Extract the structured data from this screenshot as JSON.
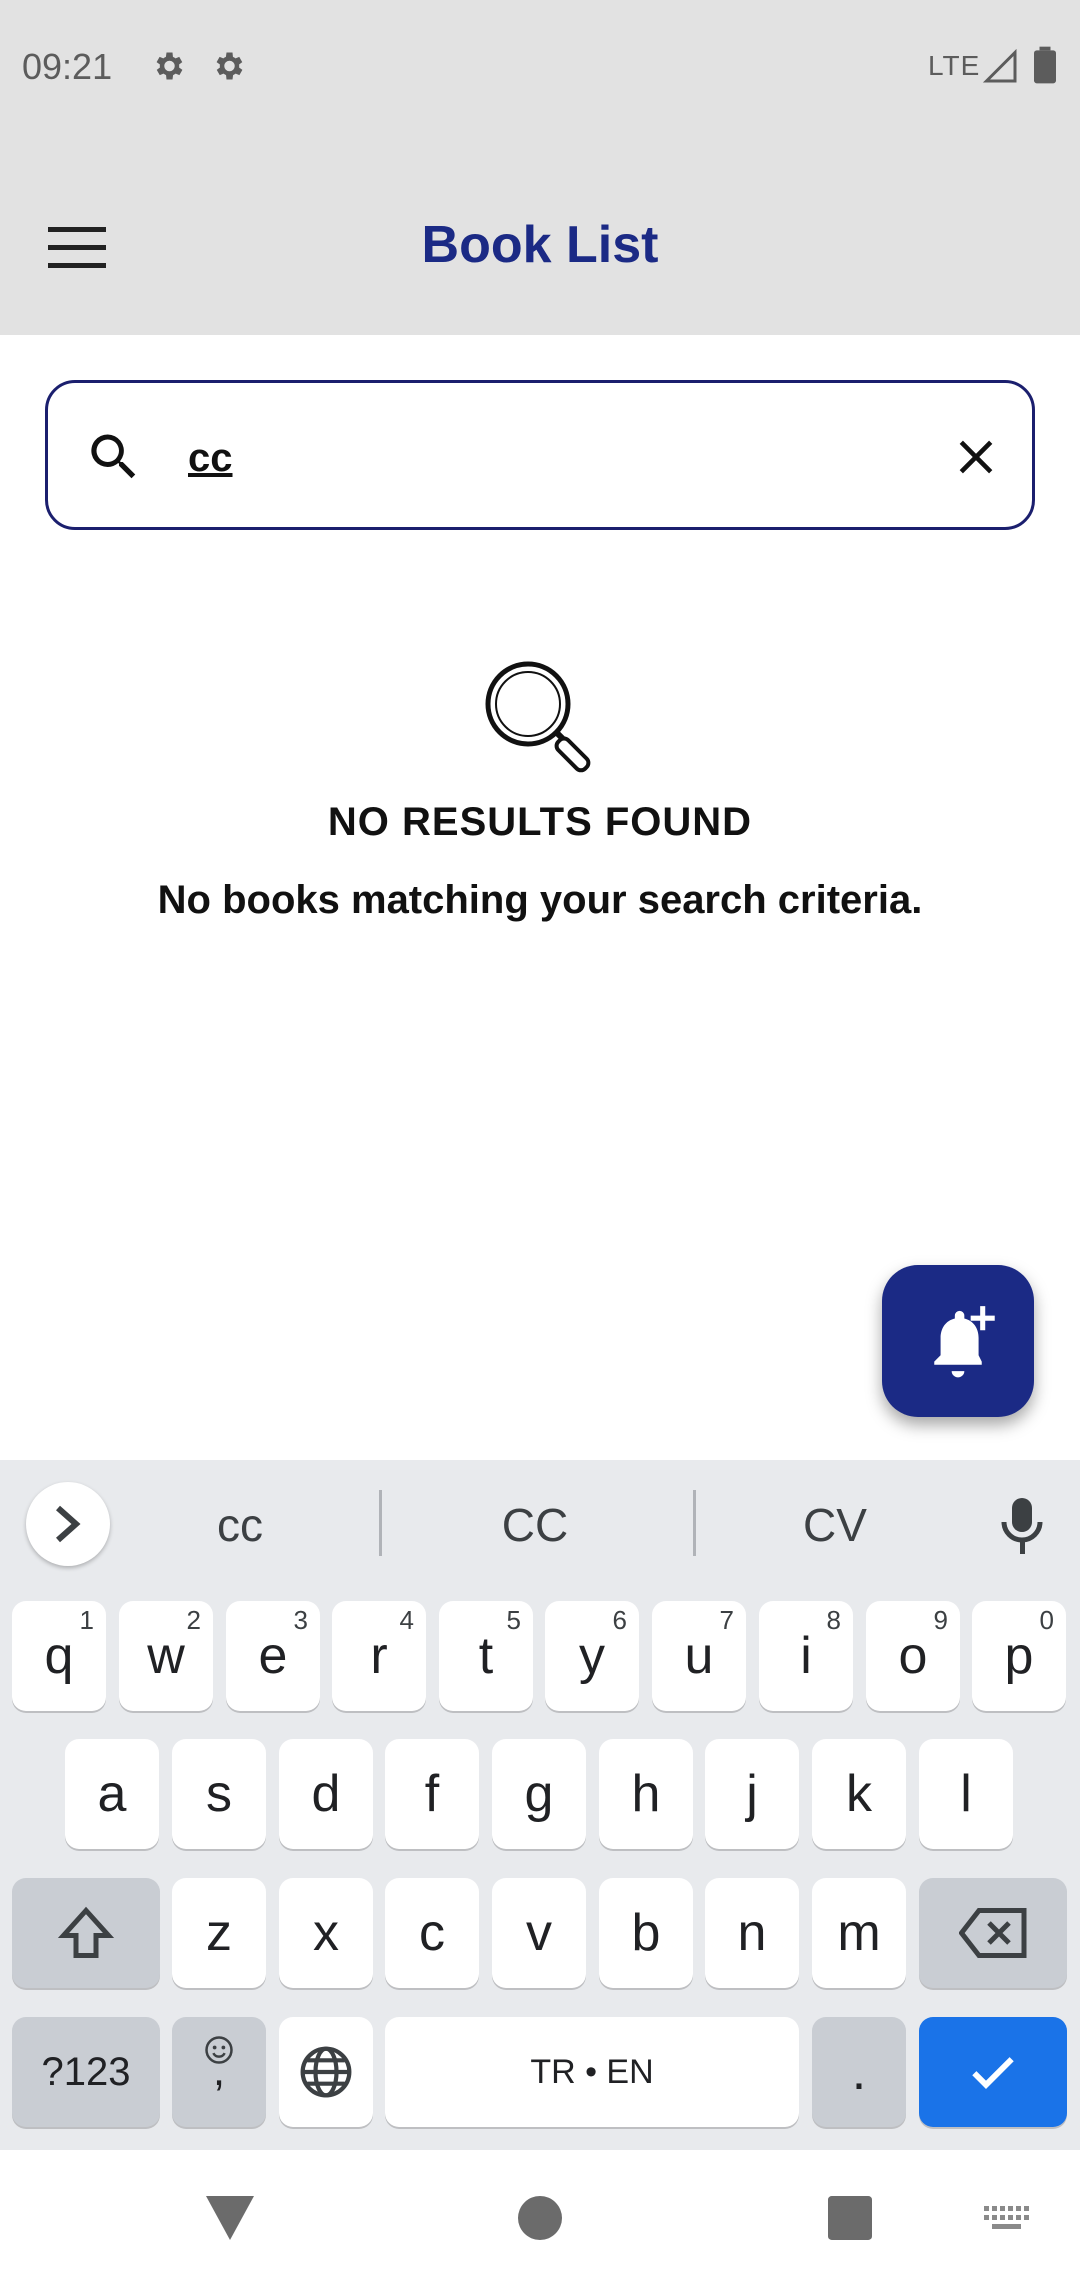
{
  "status_bar": {
    "time": "09:21",
    "network": "LTE",
    "icons": [
      "gear-icon",
      "gear-icon",
      "signal-icon",
      "battery-icon"
    ]
  },
  "app_bar": {
    "title": "Book List",
    "menu_icon": "hamburger-menu-icon"
  },
  "search": {
    "value": "cc",
    "icon": "search-icon",
    "clear_icon": "close-icon"
  },
  "empty_state": {
    "icon": "magnifier-icon",
    "title": "NO RESULTS FOUND",
    "subtitle": "No books matching your search criteria."
  },
  "fab": {
    "icon": "add-alert-bell-icon"
  },
  "keyboard": {
    "suggestions": [
      "cc",
      "CC",
      "CV"
    ],
    "row1": [
      {
        "key": "q",
        "hint": "1"
      },
      {
        "key": "w",
        "hint": "2"
      },
      {
        "key": "e",
        "hint": "3"
      },
      {
        "key": "r",
        "hint": "4"
      },
      {
        "key": "t",
        "hint": "5"
      },
      {
        "key": "y",
        "hint": "6"
      },
      {
        "key": "u",
        "hint": "7"
      },
      {
        "key": "i",
        "hint": "8"
      },
      {
        "key": "o",
        "hint": "9"
      },
      {
        "key": "p",
        "hint": "0"
      }
    ],
    "row2": [
      "a",
      "s",
      "d",
      "f",
      "g",
      "h",
      "j",
      "k",
      "l"
    ],
    "row3": [
      "z",
      "x",
      "c",
      "v",
      "b",
      "n",
      "m"
    ],
    "symbols_label": "?123",
    "emoji_key_label": ",",
    "space_label": "TR • EN",
    "period_label": ".",
    "accent_color": "#1a73e8"
  },
  "colors": {
    "primary": "#1b2a85",
    "app_bar_bg": "#e2e2e2"
  }
}
